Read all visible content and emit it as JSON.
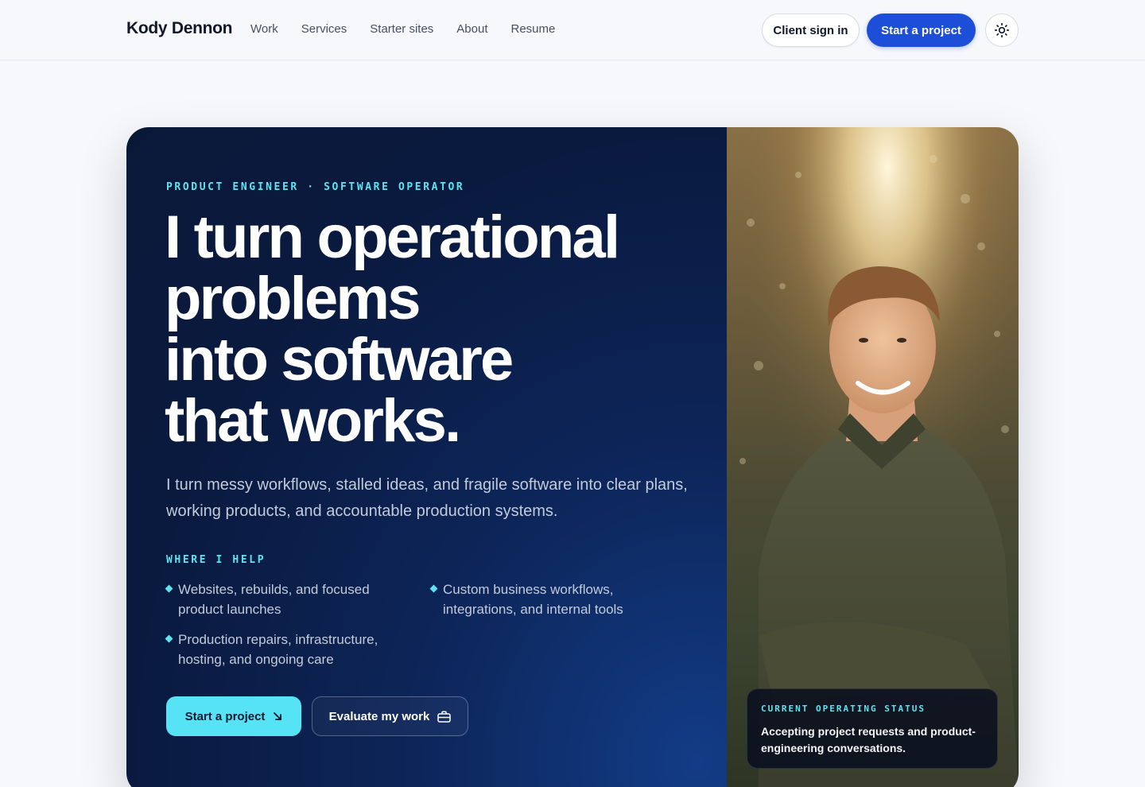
{
  "header": {
    "brand": "Kody Dennon",
    "nav": [
      "Work",
      "Services",
      "Starter sites",
      "About",
      "Resume"
    ],
    "client_signin": "Client sign in",
    "start_project": "Start a project",
    "theme_toggle_icon": "sun-icon"
  },
  "hero": {
    "eyebrow": "PRODUCT ENGINEER · SOFTWARE OPERATOR",
    "headline": [
      "I turn operational",
      "problems",
      "into software",
      "that works."
    ],
    "lede": "I turn messy workflows, stalled ideas, and fragile software into clear plans, working products, and accountable production systems.",
    "help_label": "WHERE I HELP",
    "help_items": [
      "Websites, rebuilds, and focused product launches",
      "Custom business workflows, integrations, and internal tools",
      "Production repairs, infrastructure, hosting, and ongoing care"
    ],
    "cta_primary": "Start a project",
    "cta_primary_icon": "arrow-down-right-icon",
    "cta_secondary": "Evaluate my work",
    "cta_secondary_icon": "briefcase-icon"
  },
  "status": {
    "label": "CURRENT OPERATING STATUS",
    "text": "Accepting project requests and product-engineering conversations."
  },
  "colors": {
    "accent_cyan": "#5ee3f2",
    "brand_blue": "#1d4ed8",
    "hero_navy": "#0a1a3f"
  }
}
